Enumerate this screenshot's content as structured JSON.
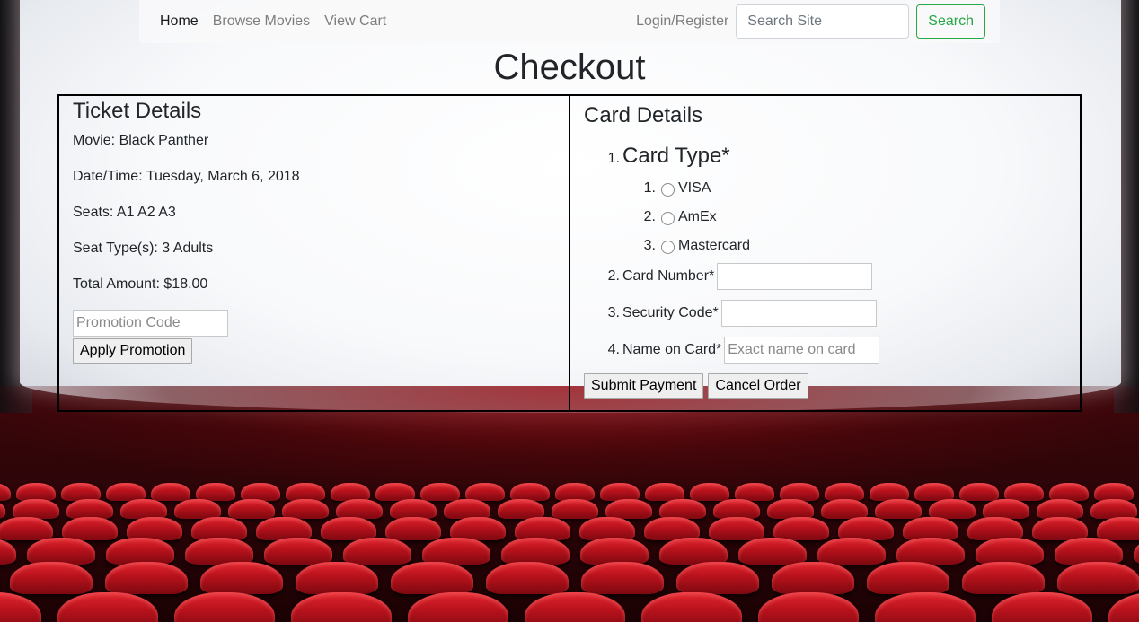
{
  "navbar": {
    "home": "Home",
    "browse": "Browse Movies",
    "cart": "View Cart",
    "login": "Login/Register",
    "search_placeholder": "Search Site",
    "search_button": "Search"
  },
  "page_title": "Checkout",
  "ticket": {
    "title": "Ticket Details",
    "movie": "Movie: Black Panther",
    "datetime": "Date/Time: Tuesday, March 6, 2018",
    "seats": "Seats: A1 A2 A3",
    "seat_types": "Seat Type(s): 3 Adults",
    "total": "Total Amount: $18.00",
    "promo_placeholder": "Promotion Code",
    "promo_button": "Apply Promotion"
  },
  "card": {
    "title": "Card Details",
    "type_label": "Card Type*",
    "types": [
      "VISA",
      "AmEx",
      "Mastercard"
    ],
    "number_label": "Card Number*",
    "security_label": "Security Code*",
    "name_label": "Name on Card*",
    "name_placeholder": "Exact name on card",
    "submit_button": "Submit Payment",
    "cancel_button": "Cancel Order"
  },
  "colors": {
    "search_accent": "#28a745",
    "seat_red": "#c4141e",
    "border": "#000000"
  }
}
